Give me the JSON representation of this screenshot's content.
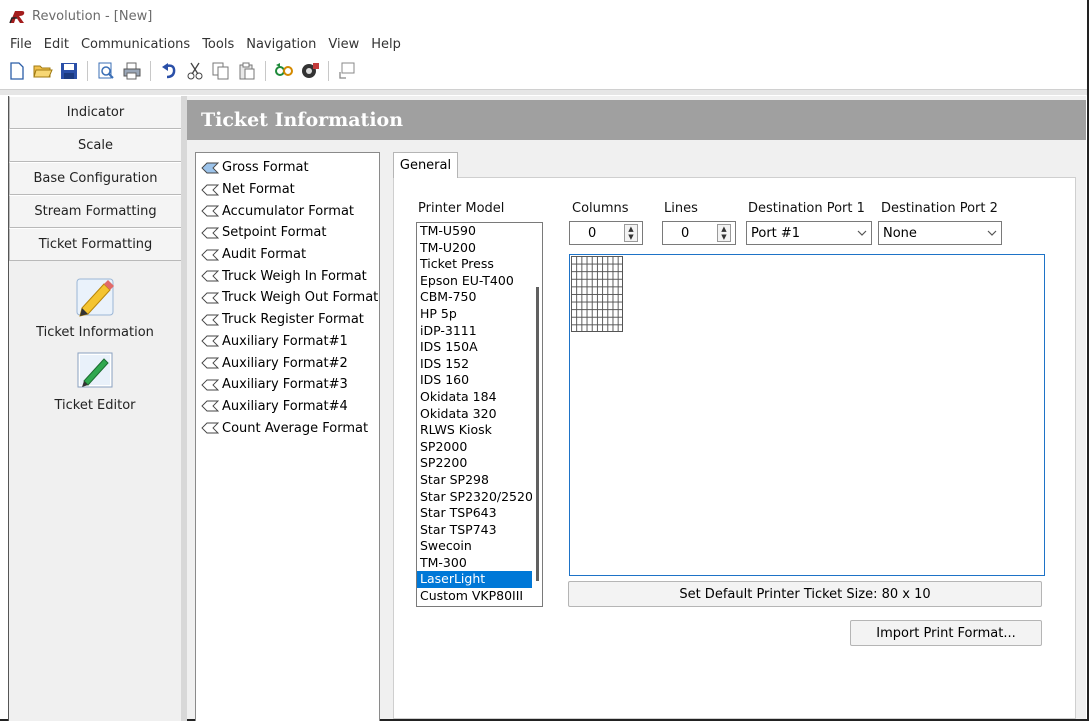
{
  "window": {
    "title": "Revolution - [New]"
  },
  "menu": [
    "File",
    "Edit",
    "Communications",
    "Tools",
    "Navigation",
    "View",
    "Help"
  ],
  "toolbar": {
    "buttons": [
      "new-file-icon",
      "open-folder-icon",
      "save-icon",
      "print-preview-icon",
      "print-icon",
      "undo-icon",
      "cut-icon",
      "copy-icon",
      "paste-icon",
      "connect-icon",
      "settings-gear-icon",
      "export-icon"
    ]
  },
  "sidebar": {
    "nav": [
      "Indicator",
      "Scale",
      "Base Configuration",
      "Stream Formatting",
      "Ticket Formatting"
    ],
    "tools": [
      {
        "label": "Ticket Information",
        "icon": "pencil-icon"
      },
      {
        "label": "Ticket Editor",
        "icon": "ticket-edit-icon"
      }
    ]
  },
  "page": {
    "title": "Ticket Information"
  },
  "formats": [
    "Gross Format",
    "Net Format",
    "Accumulator Format",
    "Setpoint Format",
    "Audit Format",
    "Truck Weigh In Format",
    "Truck Weigh Out Format",
    "Truck Register Format",
    "Auxiliary Format#1",
    "Auxiliary Format#2",
    "Auxiliary Format#3",
    "Auxiliary Format#4",
    "Count Average Format"
  ],
  "selected_format": "Gross Format",
  "tab": {
    "label": "General"
  },
  "printer": {
    "label": "Printer Model",
    "models": [
      "TM-U590",
      "TM-U200",
      "Ticket Press",
      "Epson EU-T400",
      "CBM-750",
      "HP 5p",
      "iDP-3111",
      "IDS 150A",
      "IDS 152",
      "IDS 160",
      "Okidata 184",
      "Okidata 320",
      "RLWS Kiosk",
      "SP2000",
      "SP2200",
      "Star SP298",
      "Star SP2320/2520",
      "Star TSP643",
      "Star TSP743",
      "Swecoin",
      "TM-300",
      "LaserLight",
      "Custom VKP80III"
    ],
    "selected": "LaserLight"
  },
  "columns": {
    "label": "Columns",
    "value": "0"
  },
  "lines": {
    "label": "Lines",
    "value": "0"
  },
  "dest1": {
    "label": "Destination Port 1",
    "value": "Port #1"
  },
  "dest2": {
    "label": "Destination Port 2",
    "value": "None"
  },
  "buttons": {
    "set_default": "Set Default Printer Ticket Size:  80 x 10",
    "import": "Import Print Format..."
  },
  "colors": {
    "header_band": "#a0a0a0",
    "selection": "#0078d7",
    "canvas_border": "#1e73c7"
  }
}
